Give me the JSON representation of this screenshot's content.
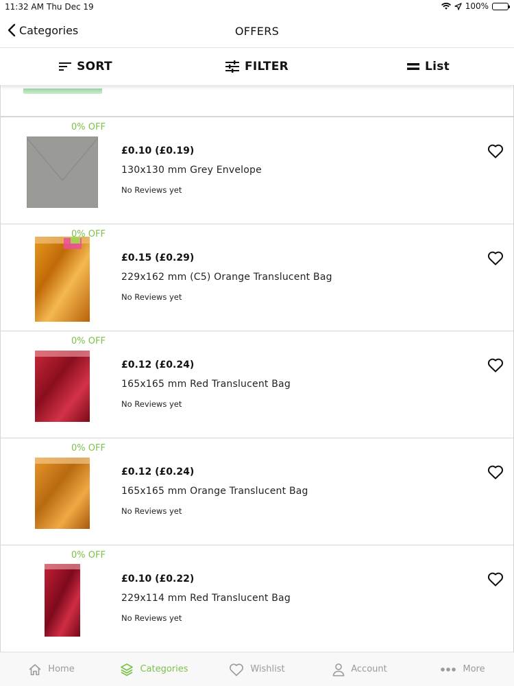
{
  "status_bar": {
    "time": "11:32 AM",
    "date": "Thu Dec 19",
    "battery": "100%"
  },
  "nav": {
    "back_label": "Categories",
    "title": "OFFERS"
  },
  "toolbar": {
    "sort_label": "SORT",
    "filter_label": "FILTER",
    "view_label": "List"
  },
  "products": [
    {
      "discount": "0% OFF",
      "price": "£0.10 (£0.19)",
      "name": "130x130 mm Grey Envelope",
      "reviews": "No Reviews yet",
      "image": "grey-envelope"
    },
    {
      "discount": "0% OFF",
      "price": "£0.15 (£0.29)",
      "name": "229x162 mm (C5) Orange Translucent Bag",
      "reviews": "No Reviews yet",
      "image": "orange-bag"
    },
    {
      "discount": "0% OFF",
      "price": "£0.12 (£0.24)",
      "name": "165x165 mm Red Translucent Bag",
      "reviews": "No Reviews yet",
      "image": "red-bag"
    },
    {
      "discount": "0% OFF",
      "price": "£0.12 (£0.24)",
      "name": "165x165 mm Orange Translucent Bag",
      "reviews": "No Reviews yet",
      "image": "orange-bag"
    },
    {
      "discount": "0% OFF",
      "price": "£0.10 (£0.22)",
      "name": "229x114 mm Red Translucent Bag",
      "reviews": "No Reviews yet",
      "image": "red-bag"
    }
  ],
  "tabs": [
    {
      "label": "Home",
      "icon": "home-icon",
      "active": false
    },
    {
      "label": "Categories",
      "icon": "layers-icon",
      "active": true
    },
    {
      "label": "Wishlist",
      "icon": "heart-icon",
      "active": false
    },
    {
      "label": "Account",
      "icon": "person-icon",
      "active": false
    },
    {
      "label": "More",
      "icon": "more-icon",
      "active": false
    }
  ],
  "colors": {
    "accent": "#7cc04a",
    "discount": "#7cc04a",
    "tab_inactive": "#9a9a9a"
  }
}
